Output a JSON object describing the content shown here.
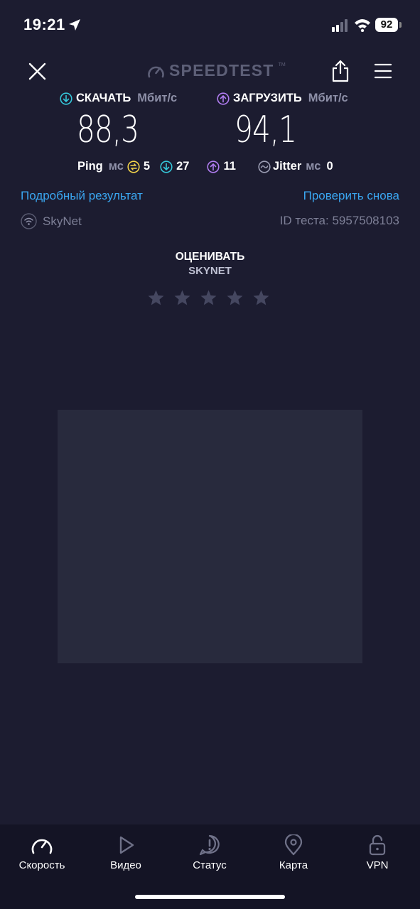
{
  "status_bar": {
    "time": "19:21",
    "battery": "92"
  },
  "header": {
    "logo": "SPEEDTEST",
    "logo_tm": "TM"
  },
  "download": {
    "label": "СКАЧАТЬ",
    "unit": "Мбит/с",
    "value": "88,3"
  },
  "upload": {
    "label": "ЗАГРУЗИТЬ",
    "unit": "Мбит/с",
    "value": "94,1"
  },
  "ping": {
    "label": "Ping",
    "unit": "мс",
    "idle": "5",
    "download": "27",
    "upload": "11",
    "jitter_label": "Jitter",
    "jitter_unit": "мс",
    "jitter": "0"
  },
  "links": {
    "detailed": "Подробный результат",
    "retest": "Проверить снова"
  },
  "isp": {
    "name": "SkyNet",
    "test_id": "ID теста: 5957508103"
  },
  "rating": {
    "title": "ОЦЕНИВАТЬ",
    "subtitle": "SKYNET",
    "stars": 5,
    "selected": 0
  },
  "tabs": [
    {
      "label": "Скорость",
      "icon": "speedometer-icon"
    },
    {
      "label": "Видео",
      "icon": "play-icon"
    },
    {
      "label": "Статус",
      "icon": "alert-icon"
    },
    {
      "label": "Карта",
      "icon": "map-pin-icon"
    },
    {
      "label": "VPN",
      "icon": "lock-icon"
    }
  ],
  "colors": {
    "background": "#1c1c30",
    "link": "#3aa6f0",
    "download_accent": "#35c6d9",
    "upload_accent": "#b07cf0",
    "ping_idle_accent": "#f2d34a"
  }
}
